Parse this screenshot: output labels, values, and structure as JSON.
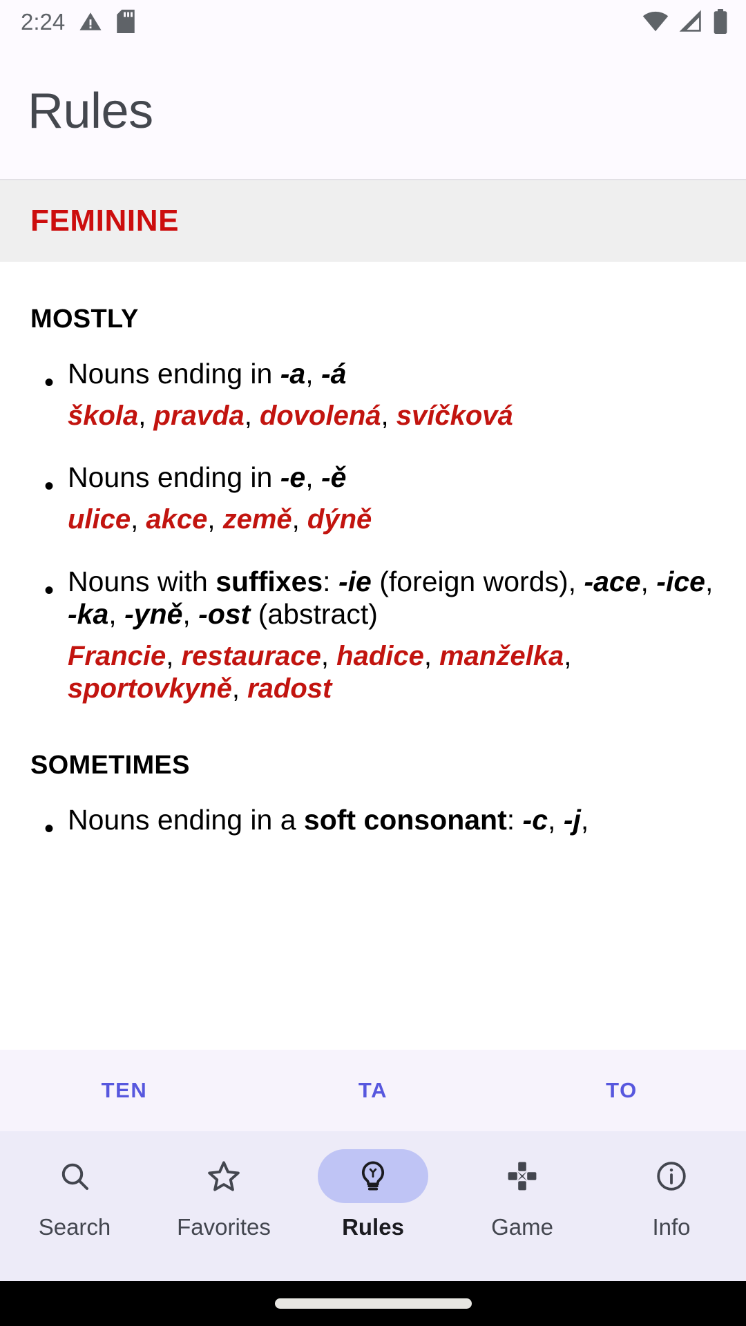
{
  "status_bar": {
    "time": "2:24",
    "left_icons": [
      "warning-triangle-icon",
      "sd-card-icon"
    ],
    "right_icons": [
      "wifi-icon",
      "cellular-signal-icon",
      "battery-icon"
    ],
    "background_color": "#FDFAFF",
    "icon_color": "#5F6368"
  },
  "app_bar": {
    "title": "Rules",
    "background_color": "#FDFAFF",
    "title_color": "#44474E"
  },
  "section": {
    "label": "FEMININE",
    "label_color": "#CC0D0D",
    "background_color": "#EFEFEF"
  },
  "content": {
    "groups": [
      {
        "heading": "MOSTLY",
        "rules": [
          {
            "text_parts": [
              {
                "text": "Nouns ending in ",
                "style": "normal"
              },
              {
                "text": "-a",
                "style": "bold-italic"
              },
              {
                "text": ", ",
                "style": "normal"
              },
              {
                "text": "-á",
                "style": "bold-italic"
              }
            ],
            "examples": [
              "škola",
              "pravda",
              "dovolená",
              "svíčková"
            ]
          },
          {
            "text_parts": [
              {
                "text": "Nouns ending in ",
                "style": "normal"
              },
              {
                "text": "-e",
                "style": "bold-italic"
              },
              {
                "text": ", ",
                "style": "normal"
              },
              {
                "text": "-ě",
                "style": "bold-italic"
              }
            ],
            "examples": [
              "ulice",
              "akce",
              "země",
              "dýně"
            ]
          },
          {
            "text_parts": [
              {
                "text": "Nouns with ",
                "style": "normal"
              },
              {
                "text": "suffixes",
                "style": "bold"
              },
              {
                "text": ": ",
                "style": "normal"
              },
              {
                "text": "-ie",
                "style": "bold-italic"
              },
              {
                "text": " (foreign words), ",
                "style": "normal"
              },
              {
                "text": "-ace",
                "style": "bold-italic"
              },
              {
                "text": ", ",
                "style": "normal"
              },
              {
                "text": "-ice",
                "style": "bold-italic"
              },
              {
                "text": ", ",
                "style": "normal"
              },
              {
                "text": "-ka",
                "style": "bold-italic"
              },
              {
                "text": ", ",
                "style": "normal"
              },
              {
                "text": "-yně",
                "style": "bold-italic"
              },
              {
                "text": ", ",
                "style": "normal"
              },
              {
                "text": "-ost",
                "style": "bold-italic"
              },
              {
                "text": " (abstract)",
                "style": "normal"
              }
            ],
            "examples": [
              "Francie",
              "restaurace",
              "hadice",
              "manželka",
              "sportovkyně",
              "radost"
            ]
          }
        ]
      },
      {
        "heading": "SOMETIMES",
        "rules": [
          {
            "text_parts": [
              {
                "text": "Nouns ending in a ",
                "style": "normal"
              },
              {
                "text": "soft consonant",
                "style": "bold"
              },
              {
                "text": ": ",
                "style": "normal"
              },
              {
                "text": "-c",
                "style": "bold-italic"
              },
              {
                "text": ", ",
                "style": "normal"
              },
              {
                "text": "-j",
                "style": "bold-italic"
              },
              {
                "text": ",",
                "style": "normal"
              }
            ],
            "examples": []
          }
        ]
      }
    ],
    "example_color": "#C2140F"
  },
  "sub_tabs": {
    "items": [
      {
        "label": "TEN"
      },
      {
        "label": "TA"
      },
      {
        "label": "TO"
      }
    ],
    "color": "#5757DE",
    "background_color": "#F7F3FC"
  },
  "bottom_nav": {
    "background_color": "#EDEBF8",
    "active_pill_color": "#BFC4F5",
    "items": [
      {
        "label": "Search",
        "icon": "search-icon",
        "active": false
      },
      {
        "label": "Favorites",
        "icon": "star-icon",
        "active": false
      },
      {
        "label": "Rules",
        "icon": "lightbulb-icon",
        "active": true
      },
      {
        "label": "Game",
        "icon": "dpad-icon",
        "active": false
      },
      {
        "label": "Info",
        "icon": "info-icon",
        "active": false
      }
    ]
  },
  "gesture_bar": {
    "background_color": "#000000",
    "pill_color": "#E7E6E2"
  }
}
